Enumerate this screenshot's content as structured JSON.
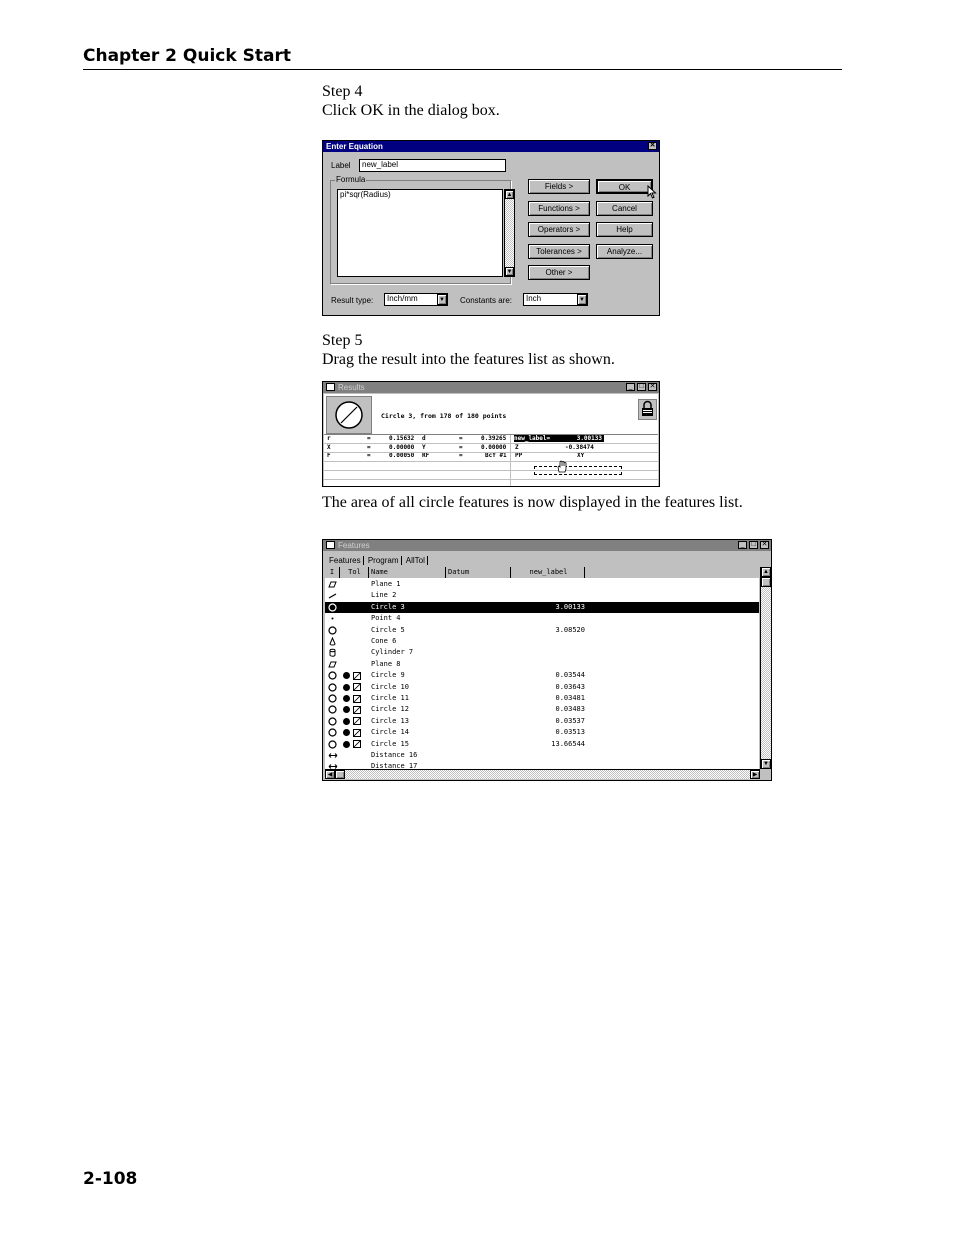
{
  "page": {
    "header": "Chapter 2 Quick Start",
    "footer": "2-108",
    "step4_title": "Step 4",
    "step4_text": "Click OK in the dialog box.",
    "step5_title": "Step 5",
    "step5_text": "Drag the result into the features list as shown.",
    "caption": "The area of all circle features is now displayed in the features list."
  },
  "dialog": {
    "title": "Enter Equation",
    "label_caption": "Label",
    "label_value": "new_label",
    "formula_caption": "Formula",
    "formula_value": "pi*sqr(Radius)",
    "buttons": {
      "fields": "Fields >",
      "ok": "OK",
      "functions": "Functions >",
      "cancel": "Cancel",
      "operators": "Operators >",
      "help": "Help",
      "tolerances": "Tolerances >",
      "analyze": "Analyze...",
      "other": "Other >"
    },
    "result_type_caption": "Result type:",
    "result_type_value": "Inch/mm",
    "constants_caption": "Constants are:",
    "constants_value": "Inch"
  },
  "results": {
    "title": "Results",
    "summary": "Circle 3, from 178 of 180 points",
    "rows": [
      [
        "r",
        "=",
        "0.15632",
        "d",
        "=",
        "0.39265",
        "new_label=",
        "3.00133"
      ],
      [
        "X",
        "=",
        "0.00000",
        "Y",
        "=",
        "0.00000",
        "Z",
        "-0.38474"
      ],
      [
        "F",
        "=",
        "0.00050",
        "RF",
        "=",
        "Bcf #1",
        "PP",
        "XY"
      ]
    ]
  },
  "features": {
    "title": "Features",
    "tabs": [
      "Features",
      "Program",
      "AllTol"
    ],
    "columns": [
      "I",
      "Tol",
      "Name",
      "Datum",
      "new_label"
    ],
    "rows": [
      {
        "icon": "plane",
        "tol": false,
        "name": "Plane 1",
        "value": ""
      },
      {
        "icon": "line",
        "tol": false,
        "name": "Line 2",
        "value": ""
      },
      {
        "icon": "circle",
        "tol": false,
        "name": "Circle 3",
        "value": "3.00133",
        "selected": true
      },
      {
        "icon": "point",
        "tol": false,
        "name": "Point 4",
        "value": ""
      },
      {
        "icon": "circle",
        "tol": false,
        "name": "Circle 5",
        "value": "3.08520"
      },
      {
        "icon": "cone",
        "tol": false,
        "name": "Cone 6",
        "value": ""
      },
      {
        "icon": "cylinder",
        "tol": false,
        "name": "Cylinder 7",
        "value": ""
      },
      {
        "icon": "plane",
        "tol": false,
        "name": "Plane 8",
        "value": ""
      },
      {
        "icon": "circle",
        "tol": true,
        "name": "Circle 9",
        "value": "0.03544"
      },
      {
        "icon": "circle",
        "tol": true,
        "name": "Circle 10",
        "value": "0.03643"
      },
      {
        "icon": "circle",
        "tol": true,
        "name": "Circle 11",
        "value": "0.03481"
      },
      {
        "icon": "circle",
        "tol": true,
        "name": "Circle 12",
        "value": "0.03483"
      },
      {
        "icon": "circle",
        "tol": true,
        "name": "Circle 13",
        "value": "0.03537"
      },
      {
        "icon": "circle",
        "tol": true,
        "name": "Circle 14",
        "value": "0.03513"
      },
      {
        "icon": "circle",
        "tol": true,
        "name": "Circle 15",
        "value": "13.66544"
      },
      {
        "icon": "distance",
        "tol": false,
        "name": "Distance 16",
        "value": ""
      },
      {
        "icon": "distance",
        "tol": false,
        "name": "Distance 17",
        "value": ""
      }
    ]
  }
}
